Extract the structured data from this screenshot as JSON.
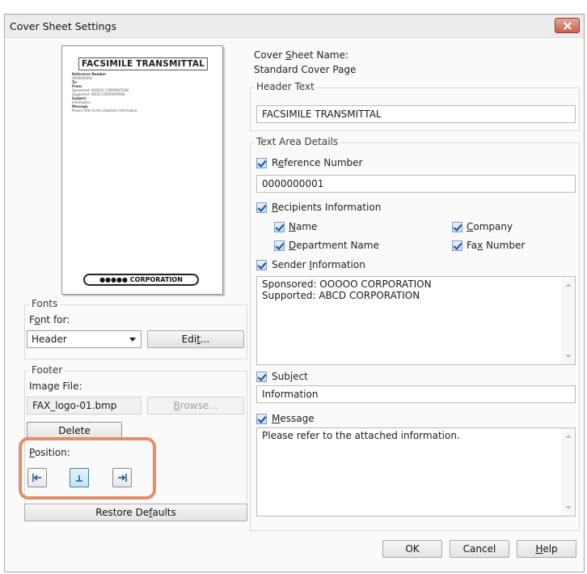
{
  "window": {
    "title": "Cover Sheet Settings"
  },
  "preview": {
    "header": "FACSIMILE TRANSMITTAL",
    "lines": [
      {
        "text": "Reference Number",
        "bold": true
      },
      {
        "text": "0000000001",
        "bold": false
      },
      {
        "text": "To:",
        "bold": true
      },
      {
        "text": "From:",
        "bold": true
      },
      {
        "text": "Sponsored: OOOOO CORPORATION",
        "bold": false
      },
      {
        "text": "Supported: ABCD CORPORATION",
        "bold": false
      },
      {
        "text": "Subject:",
        "bold": true
      },
      {
        "text": "Information",
        "bold": false
      },
      {
        "text": "Message",
        "bold": true
      },
      {
        "text": "Please refer to the attached information.",
        "bold": false
      }
    ],
    "logo": "●●●●● CORPORATION"
  },
  "fonts": {
    "group_label": "Fonts",
    "font_for_label": "Font for:",
    "selected": "Header",
    "edit_button": "Edit..."
  },
  "footer": {
    "group_label": "Footer",
    "image_file_label": "Image File:",
    "image_file": "FAX_logo-01.bmp",
    "browse_button": "Browse...",
    "delete_button": "Delete",
    "position_label": "Position:"
  },
  "restore_button": "Restore Defaults",
  "cover_sheet_name": {
    "label": "Cover Sheet Name:",
    "value": "Standard Cover Page"
  },
  "header_text": {
    "group_label": "Header Text",
    "value": "FACSIMILE TRANSMITTAL"
  },
  "text_area": {
    "group_label": "Text Area Details",
    "reference_number": {
      "label": "Reference Number",
      "value": "0000000001"
    },
    "recipients": {
      "label": "Recipients Information",
      "name": "Name",
      "company": "Company",
      "department": "Department Name",
      "fax": "Fax Number"
    },
    "sender": {
      "label": "Sender Information",
      "line1": "Sponsored: OOOOO CORPORATION",
      "line2": "Supported: ABCD CORPORATION"
    },
    "subject": {
      "label": "Subject",
      "value": "Information"
    },
    "message": {
      "label": "Message",
      "value": "Please refer to the attached information."
    }
  },
  "buttons": {
    "ok": "OK",
    "cancel": "Cancel",
    "help": "Help"
  },
  "colors": {
    "highlight": "#e48e6b",
    "close_button": "#c96151",
    "checkbox_check": "#1b4f9c"
  }
}
